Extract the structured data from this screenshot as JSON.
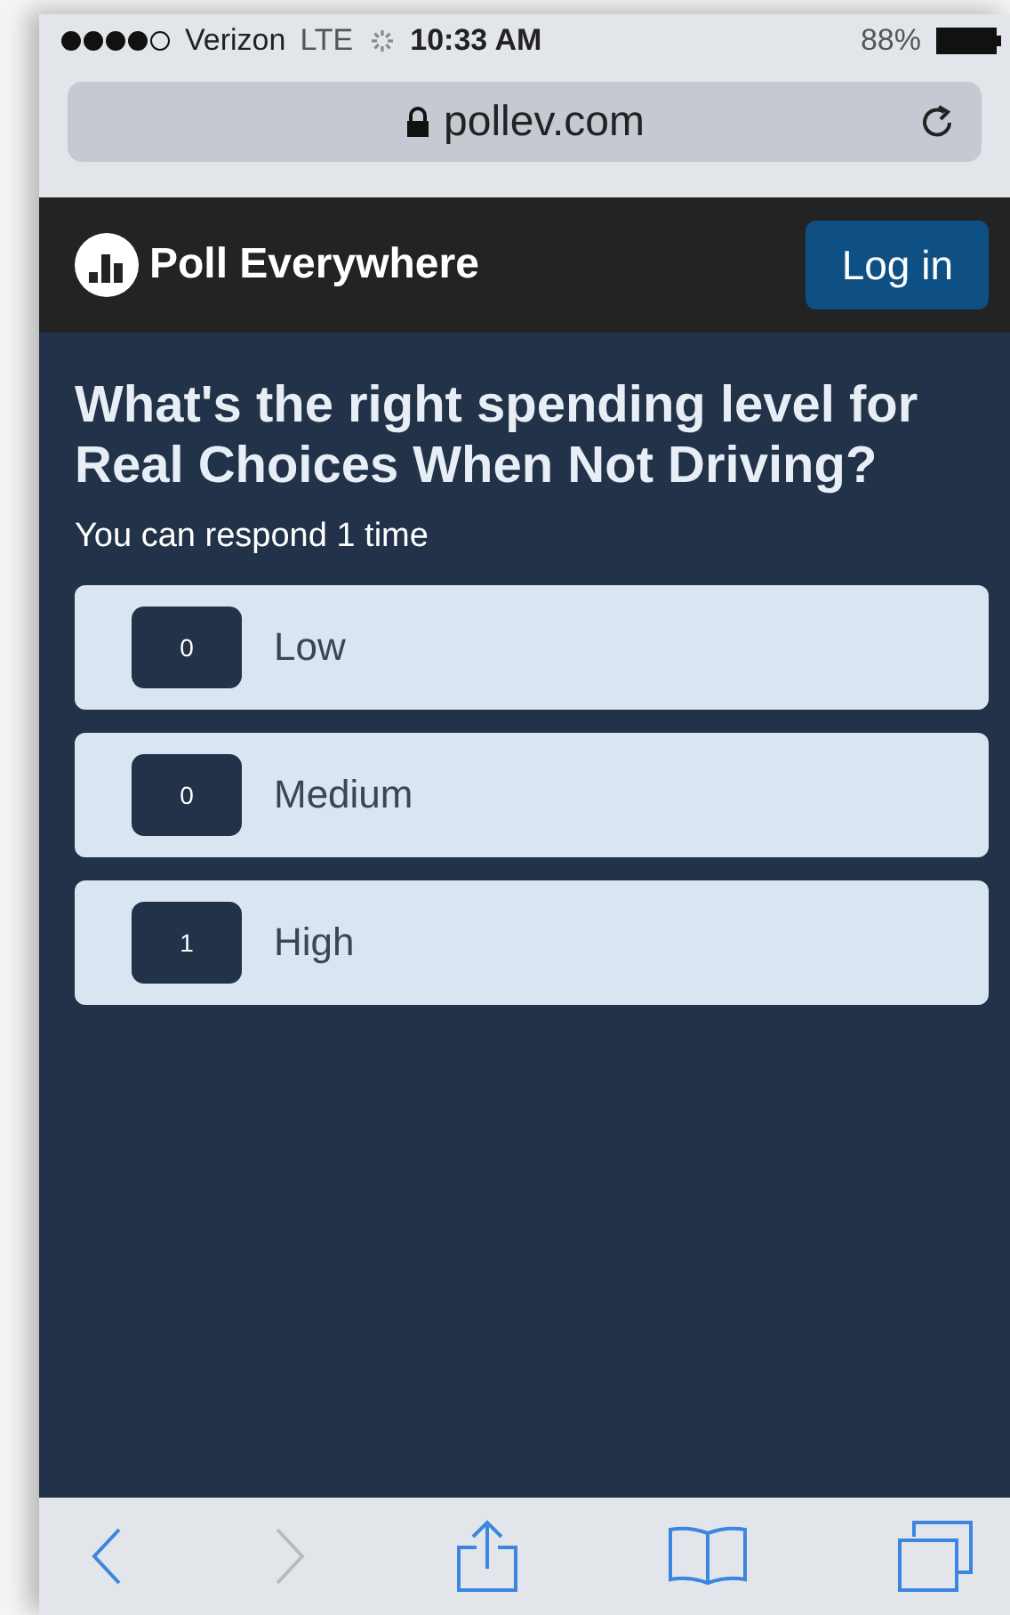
{
  "status_bar": {
    "carrier": "Verizon",
    "network": "LTE",
    "time": "10:33 AM",
    "battery": "88%"
  },
  "browser": {
    "url": "pollev.com"
  },
  "header": {
    "brand": "Poll Everywhere",
    "login_button": "Log in"
  },
  "poll": {
    "question": "What's the right spending level for Real Choices When Not Driving?",
    "note": "You can respond 1 time",
    "options": [
      {
        "count": "0",
        "label": "Low"
      },
      {
        "count": "0",
        "label": "Medium"
      },
      {
        "count": "1",
        "label": "High"
      }
    ]
  },
  "toolbar": {
    "buttons": [
      {
        "kind": "back",
        "disabled": false
      },
      {
        "kind": "forward",
        "disabled": true
      },
      {
        "kind": "share",
        "disabled": false
      },
      {
        "kind": "bookmarks",
        "disabled": false
      },
      {
        "kind": "tabs",
        "disabled": false
      }
    ]
  }
}
